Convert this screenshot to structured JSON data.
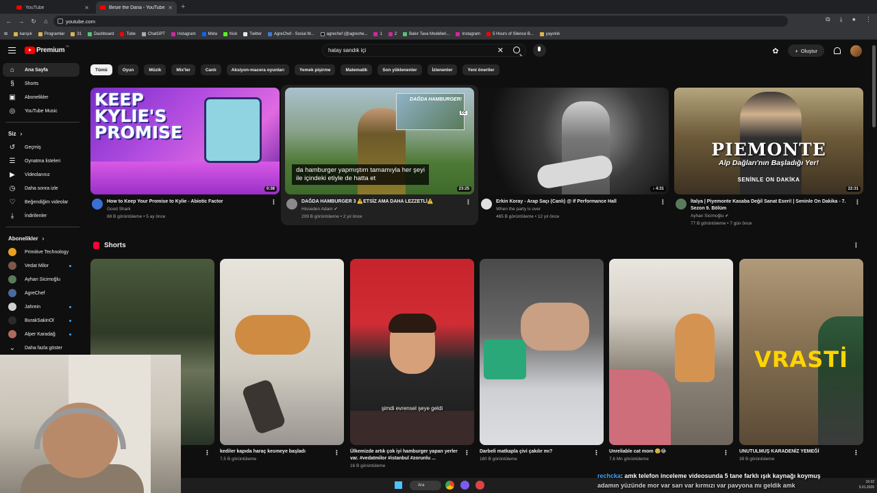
{
  "browser": {
    "tabs": [
      {
        "label": "YouTube",
        "active": false
      },
      {
        "label": "Besie the Dana - YouTube",
        "active": true
      }
    ],
    "url": "youtube.com",
    "bookmarks": [
      "karışık",
      "Programlar",
      "31",
      "Dashboard",
      "Tube",
      "ChatGPT",
      "Instagram",
      "Meta",
      "Kick",
      "Twitter",
      "AgreChef - Social M...",
      "agrechef (@agreche...",
      "1",
      "2",
      "Bakır Tava Modelleri...",
      "Instagram",
      "5 Hours of Silence B...",
      "yayınlık"
    ]
  },
  "header": {
    "logo_text": "Premium",
    "logo_sup": "TR",
    "search_value": "hatay sandık içi",
    "create_label": "Oluştur"
  },
  "sidebar": {
    "main": [
      {
        "label": "Ana Sayfa",
        "icon": "home-icon",
        "active": true
      },
      {
        "label": "Shorts",
        "icon": "shorts-icon"
      },
      {
        "label": "Abonelikler",
        "icon": "subscriptions-icon"
      },
      {
        "label": "YouTube Music",
        "icon": "music-icon"
      }
    ],
    "you_header": "Siz",
    "you": [
      {
        "label": "Geçmiş",
        "icon": "history-icon"
      },
      {
        "label": "Oynatma listeleri",
        "icon": "playlist-icon"
      },
      {
        "label": "Videolarınız",
        "icon": "video-icon"
      },
      {
        "label": "Daha sonra izle",
        "icon": "clock-icon"
      },
      {
        "label": "Beğendiğim videolar",
        "icon": "like-icon"
      },
      {
        "label": "İndirilenler",
        "icon": "download-icon"
      }
    ],
    "subs_header": "Abonelikler",
    "subs": [
      {
        "label": "Primitive Technology",
        "color": "#e8a020",
        "dot": false
      },
      {
        "label": "Vedat Milor",
        "color": "#7a5a4a",
        "dot": true
      },
      {
        "label": "Ayhan Sicimoğlu",
        "color": "#5a7a5a",
        "dot": false
      },
      {
        "label": "AgreChef",
        "color": "#4a6a9a",
        "dot": false
      },
      {
        "label": "Jahrein",
        "color": "#d0d0d0",
        "dot": true
      },
      {
        "label": "BurakSakinOl",
        "color": "#2a2a2a",
        "dot": true
      },
      {
        "label": "Alper Karadağ",
        "color": "#b06a5a",
        "dot": true
      }
    ],
    "more_label": "Daha fazla göster"
  },
  "chips": [
    "Tümü",
    "Oyun",
    "Müzik",
    "Mix'ler",
    "Canlı",
    "Aksiyon-macera oyunları",
    "Yemek pişirme",
    "Matematik",
    "Son yüklenenler",
    "İzlenenler",
    "Yeni öneriler"
  ],
  "videos": [
    {
      "title": "How to Keep Your Promise to Kylie - Abiotic Factor",
      "channel": "Good Shark",
      "meta": "88 B görüntüleme • 5 ay önce",
      "duration": "0:38",
      "thumb_text": "KEEP KYLIE'S PROMISE",
      "avatar_color": "#3b6fd6"
    },
    {
      "title": "DAĞDA HAMBURGER 3 ⚠️ETSİZ AMA DAHA LEZZETLİ⚠️",
      "channel": "Hisseden Adam ✔",
      "meta": "209 B görüntüleme • 2 yıl önce",
      "duration": "23:25",
      "caption": "da hamburger yapmıştım tamamıyla her şeyi ile içindeki etiyle de hatta et",
      "inset_text": "DAĞDA HAMBURGER!",
      "cc": "CC",
      "avatar_color": "#8a8a8a"
    },
    {
      "title": "Erkin Koray - Arap Saçı (Canlı) @ If Performance Hall",
      "channel": "When the party is over",
      "meta": "465 B görüntüleme • 12 yıl önce",
      "duration": "♪ 4:31",
      "avatar_color": "#e0e0e0"
    },
    {
      "title": "İtalya | Piyemonte Kasaba Değil Sanat Eseri! | Seninle On Dakika - 7. Sezon 9. Bölüm",
      "channel": "Ayhan Sicimoğlu ✔",
      "meta": "77 B görüntüleme • 7 gün önce",
      "duration": "22:31",
      "thumb_title": "PIEMONTE",
      "thumb_sub": "Alp Dağları'nın Başladığı Yer!",
      "thumb_brand": "SENİNLE ON DAKİKA",
      "avatar_color": "#5a7a5a"
    }
  ],
  "shorts_title": "Shorts",
  "shorts": [
    {
      "title": "❤️ - ...ulder ...",
      "meta": ""
    },
    {
      "title": "kediler kapıda haraç kesmeye başladı",
      "meta": "7,5 B görüntüleme"
    },
    {
      "title": "Ülkemizde artık çok iyi hamburger yapan yerler var. #vedatmilor #istanbul #zorunlu ...",
      "meta": "16 B görüntüleme",
      "subtitle": "şimdi evrensel şeye geldi"
    },
    {
      "title": "Darbeli matkapla çivi çakılır mı?",
      "meta": "180 B görüntüleme"
    },
    {
      "title": "Unreliable cat mom 🥹😂",
      "meta": "7,6 Mn görüntüleme"
    },
    {
      "title": "UNUTULMUŞ KARADENİZ YEMEĞİ",
      "meta": "39 B görüntüleme",
      "thumb_text": "VRASTİ"
    }
  ],
  "chat": {
    "user": "rechcka",
    "line1": ": amk telefon inceleme videosunda 5 tane farklı ışık kaynağı koymuş",
    "line2": "adamın yüzünde mor var sarı var kırmızı var pavyona mı geldik amk"
  },
  "taskbar": {
    "search_label": "Ara",
    "time": "16:32",
    "date": "5.01.2026"
  }
}
